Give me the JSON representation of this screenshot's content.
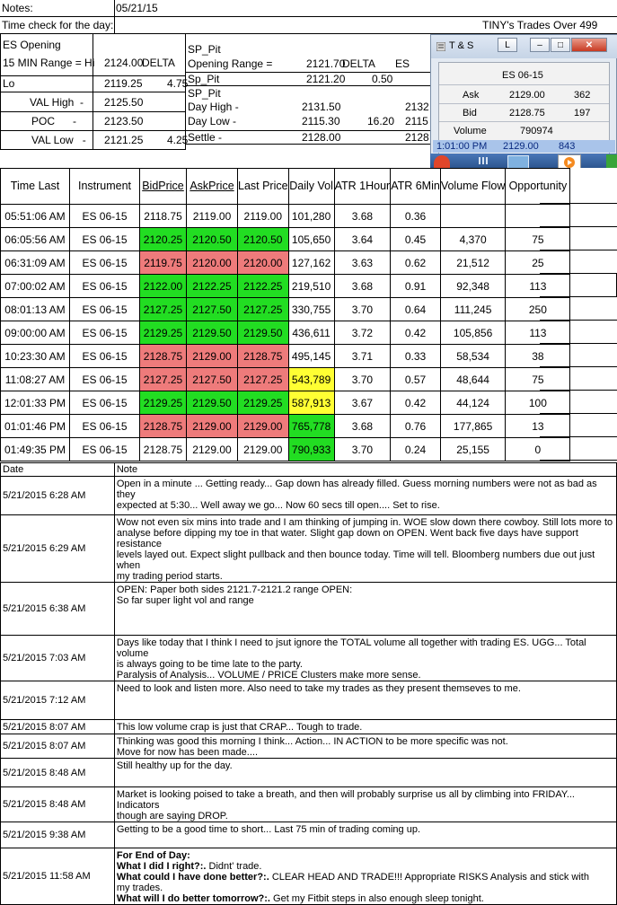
{
  "header": {
    "notes_label": "Notes:",
    "date_value": "05/21/15",
    "time_check": "Time check for the day:",
    "trades_title": "TINY's Trades Over 499"
  },
  "levels_left": {
    "opening": "ES Opening",
    "range_label": "15 MIN Range = Hi",
    "range_value": "2124.00",
    "range_unit": "DELTA",
    "lo_label": "Lo",
    "lo_value": "2119.25",
    "lo_delta": "4.75",
    "val_high_label": "VAL High",
    "val_high_dash": "-",
    "val_high_value": "2125.50",
    "poc_label": "POC",
    "poc_dash": "-",
    "poc_value": "2123.50",
    "val_low_label": "VAL Low",
    "val_low_dash": "-",
    "val_low_value": "2121.25",
    "val_low_delta": "4.25"
  },
  "levels_right": {
    "sp_pit": "SP_Pit",
    "opening_range": "Opening Range =",
    "opening_range_value": "2121.70",
    "delta_label": "DELTA",
    "es_label": "ES",
    "sp_pit2": "Sp_Pit",
    "sp_pit2_value": "2121.20",
    "sp_pit2_delta": "0.50",
    "sp_pit3": "SP_Pit",
    "day_high": "Day High -",
    "day_high_value": "2131.50",
    "day_high_es": "2132",
    "day_low": "Day Low -",
    "day_low_value": "2115.30",
    "day_low_delta": "16.20",
    "day_low_es": "2115",
    "settle": "Settle -",
    "settle_value": "2128.00",
    "settle_es": "2128"
  },
  "ts_window": {
    "title": "T & S",
    "btn_l": "L",
    "symbol": "ES 06-15",
    "ask_label": "Ask",
    "ask_price": "2129.00",
    "ask_size": "362",
    "bid_label": "Bid",
    "bid_price": "2128.75",
    "bid_size": "197",
    "volume_label": "Volume",
    "volume_value": "790974",
    "status_time": "1:01:00 PM",
    "status_price": "2129.00",
    "status_size": "843"
  },
  "table": {
    "headers": [
      "Time Last",
      "Instrument",
      "BidPrice",
      "AskPrice",
      "Last Price",
      "Daily Vol",
      "ATR 1Hour",
      "ATR 6Min",
      "Volume Flow",
      "Opportunity"
    ],
    "rows": [
      {
        "time": "05:51:06 AM",
        "inst": "ES 06-15",
        "bid": "2118.75",
        "ask": "2119.00",
        "last": "2119.00",
        "vol": "101,280",
        "atr1": "3.68",
        "atr6": "0.36",
        "flow": "",
        "opp": "",
        "color": "",
        "volcolor": ""
      },
      {
        "time": "06:05:56 AM",
        "inst": "ES 06-15",
        "bid": "2120.25",
        "ask": "2120.50",
        "last": "2120.50",
        "vol": "105,650",
        "atr1": "3.64",
        "atr6": "0.45",
        "flow": "4,370",
        "opp": "75",
        "color": "green",
        "volcolor": ""
      },
      {
        "time": "06:31:09 AM",
        "inst": "ES 06-15",
        "bid": "2119.75",
        "ask": "2120.00",
        "last": "2120.00",
        "vol": "127,162",
        "atr1": "3.63",
        "atr6": "0.62",
        "flow": "21,512",
        "opp": "25",
        "color": "red",
        "volcolor": ""
      },
      {
        "time": "07:00:02 AM",
        "inst": "ES 06-15",
        "bid": "2122.00",
        "ask": "2122.25",
        "last": "2122.25",
        "vol": "219,510",
        "atr1": "3.68",
        "atr6": "0.91",
        "flow": "92,348",
        "opp": "113",
        "color": "green",
        "volcolor": ""
      },
      {
        "time": "08:01:13 AM",
        "inst": "ES 06-15",
        "bid": "2127.25",
        "ask": "2127.50",
        "last": "2127.25",
        "vol": "330,755",
        "atr1": "3.70",
        "atr6": "0.64",
        "flow": "111,245",
        "opp": "250",
        "color": "green",
        "volcolor": ""
      },
      {
        "time": "09:00:00 AM",
        "inst": "ES 06-15",
        "bid": "2129.25",
        "ask": "2129.50",
        "last": "2129.50",
        "vol": "436,611",
        "atr1": "3.72",
        "atr6": "0.42",
        "flow": "105,856",
        "opp": "113",
        "color": "green",
        "volcolor": ""
      },
      {
        "time": "10:23:30 AM",
        "inst": "ES 06-15",
        "bid": "2128.75",
        "ask": "2129.00",
        "last": "2128.75",
        "vol": "495,145",
        "atr1": "3.71",
        "atr6": "0.33",
        "flow": "58,534",
        "opp": "38",
        "color": "red",
        "volcolor": ""
      },
      {
        "time": "11:08:27 AM",
        "inst": "ES 06-15",
        "bid": "2127.25",
        "ask": "2127.50",
        "last": "2127.25",
        "vol": "543,789",
        "atr1": "3.70",
        "atr6": "0.57",
        "flow": "48,644",
        "opp": "75",
        "color": "red",
        "volcolor": "yellow"
      },
      {
        "time": "12:01:33 PM",
        "inst": "ES 06-15",
        "bid": "2129.25",
        "ask": "2129.50",
        "last": "2129.25",
        "vol": "587,913",
        "atr1": "3.67",
        "atr6": "0.42",
        "flow": "44,124",
        "opp": "100",
        "color": "green",
        "volcolor": "yellow"
      },
      {
        "time": "01:01:46 PM",
        "inst": "ES 06-15",
        "bid": "2128.75",
        "ask": "2129.00",
        "last": "2129.00",
        "vol": "765,778",
        "atr1": "3.68",
        "atr6": "0.76",
        "flow": "177,865",
        "opp": "13",
        "color": "red",
        "volcolor": "green"
      },
      {
        "time": "01:49:35 PM",
        "inst": "ES 06-15",
        "bid": "2128.75",
        "ask": "2129.00",
        "last": "2129.00",
        "vol": "790,933",
        "atr1": "3.70",
        "atr6": "0.24",
        "flow": "25,155",
        "opp": "0",
        "color": "",
        "volcolor": "green"
      }
    ]
  },
  "notes": {
    "date_header": "Date",
    "note_header": "Note",
    "entries": [
      {
        "date": "5/21/2015 6:28 AM",
        "lines": [
          "Open in a minute ... Getting ready... Gap down has already filled.  Guess morning numbers were not as bad as they",
          "expected at 5:30... Well away we go... Now 60 secs till open.... Set to rise."
        ]
      },
      {
        "date": "5/21/2015 6:29 AM",
        "lines": [
          "Wow not even six mins into trade and I am thinking of jumping in.  WOE slow down there cowboy.  Still lots more to",
          "analyse before dipping my toe in that water.  Slight gap down on OPEN.  Went back five days have support resistance",
          "levels layed out.  Expect slight pullback and then bounce today.  Time will tell.  Bloomberg numbers due out just when",
          "my trading period starts."
        ]
      },
      {
        "date": "5/21/2015 6:38 AM",
        "lines": [
          "OPEN: Paper both sides 2121.7-2121.2 range OPEN:",
          "So far super light vol and range"
        ]
      },
      {
        "date": "5/21/2015 7:03 AM",
        "lines": [
          "Days like today that I think I need to jsut ignore the TOTAL volume all together with trading ES.   UGG... Total volume",
          "is always going to be time late to the party.",
          "Paralysis of Analysis... VOLUME / PRICE Clusters make more sense."
        ]
      },
      {
        "date": "5/21/2015 7:12 AM",
        "lines": [
          "Need to look and listen more.  Also need to take my trades as they present themseves to me."
        ]
      },
      {
        "date": "5/21/2015 8:07 AM",
        "lines": [
          "This low volume crap is just that CRAP... Tough to trade."
        ]
      },
      {
        "date": "5/21/2015 8:07 AM",
        "lines": [
          "Thinking was good this morning I think... Action... IN ACTION to be more specific was not.",
          "Move for now has been made...."
        ]
      },
      {
        "date": "5/21/2015 8:48 AM",
        "lines": [
          "Still healthy up for the day."
        ]
      },
      {
        "date": "5/21/2015 8:48 AM",
        "lines": [
          "Market is looking poised to take a breath, and then will probably surprise us all by climbing into FRIDAY...  Indicators",
          "though are saying DROP."
        ]
      },
      {
        "date": "5/21/2015 9:38 AM",
        "lines": [
          "Getting to be a good time to short... Last 75 min of trading coming up."
        ]
      },
      {
        "date": "5/21/2015 11:58 AM",
        "eod": true,
        "eod_title": "For End of Day:",
        "q1": "What I did I right?:.",
        "a1": " Didnt' trade.",
        "q2": "What could I have done better?:.",
        "a2": "  CLEAR HEAD AND TRADE!!! Appropriate RISKS Analysis and stick with",
        "a2b": "my trades.",
        "q3": "What will I do better tomorrow?:.",
        "a3": " Get my Fitbit steps in also enough sleep tonight."
      }
    ]
  },
  "colors": {
    "green": "#22dd22",
    "red": "#ee7b7b",
    "yellow": "#ffff33",
    "ts_status": "#a9c4ea"
  }
}
